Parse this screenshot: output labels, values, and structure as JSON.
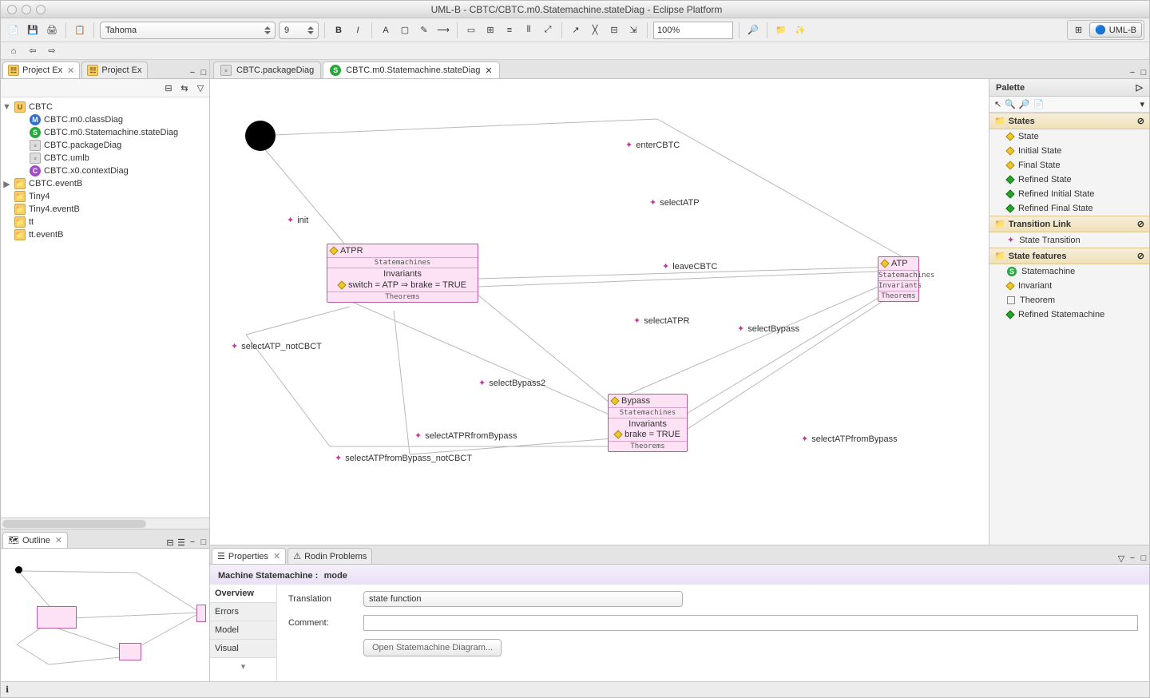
{
  "window": {
    "title": "UML-B - CBTC/CBTC.m0.Statemachine.stateDiag - Eclipse Platform"
  },
  "toolbar": {
    "font": "Tahoma",
    "fontsize": "9",
    "zoom": "100%",
    "persp_umlb": "UML-B"
  },
  "project_explorer": {
    "tab1": "Project Ex",
    "tab2": "Project Ex",
    "root": "CBTC",
    "items": [
      "CBTC.m0.classDiag",
      "CBTC.m0.Statemachine.stateDiag",
      "CBTC.packageDiag",
      "CBTC.umlb",
      "CBTC.x0.contextDiag"
    ],
    "others": [
      "CBTC.eventB",
      "Tiny4",
      "Tiny4.eventB",
      "tt",
      "tt.eventB"
    ]
  },
  "outline": {
    "title": "Outline"
  },
  "editors": {
    "tab1": "CBTC.packageDiag",
    "tab2": "CBTC.m0.Statemachine.stateDiag"
  },
  "diagram": {
    "atpr": {
      "name": "ATPR",
      "sec1": "Statemachines",
      "inv_hdr": "Invariants",
      "inv": "switch = ATP ⇒ brake = TRUE",
      "thm": "Theorems"
    },
    "atp": {
      "name": "ATP",
      "sec1": "Statemachines",
      "inv_hdr": "Invariants",
      "thm": "Theorems"
    },
    "bypass": {
      "name": "Bypass",
      "sec1": "Statemachines",
      "inv_hdr": "Invariants",
      "inv": "brake = TRUE",
      "thm": "Theorems"
    },
    "labels": {
      "init": "init",
      "enterCBTC": "enterCBTC",
      "selectATP": "selectATP",
      "leaveCBTC": "leaveCBTC",
      "selectATPR": "selectATPR",
      "selectBypass": "selectBypass",
      "selectATP_notCBCT": "selectATP_notCBCT",
      "selectBypass2": "selectBypass2",
      "selectATPRfromBypass": "selectATPRfromBypass",
      "selectATPfromBypass": "selectATPfromBypass",
      "selectATPfromBypass_notCBCT": "selectATPfromBypass_notCBCT"
    }
  },
  "palette": {
    "title": "Palette",
    "states_hdr": "States",
    "states": [
      "State",
      "Initial State",
      "Final State",
      "Refined State",
      "Refined Initial State",
      "Refined Final State"
    ],
    "tlink_hdr": "Transition Link",
    "tlink": [
      "State Transition"
    ],
    "feat_hdr": "State features",
    "feat": [
      "Statemachine",
      "Invariant",
      "Theorem",
      "Refined Statemachine"
    ]
  },
  "properties": {
    "tab1": "Properties",
    "tab2": "Rodin Problems",
    "header_label": "Machine Statemachine :",
    "header_value": "mode",
    "sidetabs": [
      "Overview",
      "Errors",
      "Model",
      "Visual"
    ],
    "translation_label": "Translation",
    "translation_value": "state function",
    "comment_label": "Comment:",
    "open_btn": "Open Statemachine Diagram..."
  }
}
